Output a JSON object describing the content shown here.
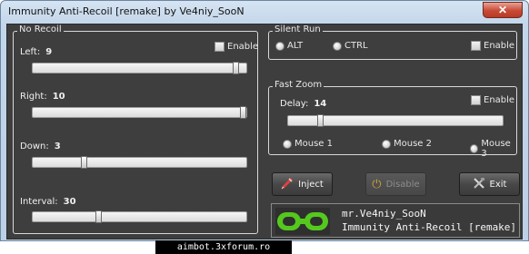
{
  "window": {
    "title": "Immunity Anti-Recoil [remake] by Ve4niy_SooN",
    "close_glyph": "✕"
  },
  "no_recoil": {
    "label": "No Recoil",
    "enable_label": "Enable",
    "sliders": [
      {
        "label": "Left:",
        "value": "9",
        "level": 0.96
      },
      {
        "label": "Right:",
        "value": "10",
        "level": 0.995
      },
      {
        "label": "Down:",
        "value": "3",
        "level": 0.23
      },
      {
        "label": "Interval:",
        "value": "30",
        "level": 0.3
      }
    ]
  },
  "silent_run": {
    "label": "Silent Run",
    "option_alt": "ALT",
    "option_ctrl": "CTRL",
    "enable_label": "Enable"
  },
  "fast_zoom": {
    "label": "Fast Zoom",
    "delay_label": "Delay:",
    "delay_value": "14",
    "delay_level": 0.14,
    "enable_label": "Enable",
    "mouse1": "Mouse 1",
    "mouse2": "Mouse 2",
    "mouse3": "Mouse 3"
  },
  "actions": {
    "inject": "Inject",
    "disable": "Disable",
    "exit": "Exit"
  },
  "logo_panel": {
    "line1": "mr.Ve4niy_SooN",
    "line2": "Immunity Anti-Recoil [remake]"
  },
  "watermark": "aimbot.3xforum.ro",
  "colors": {
    "logo_green": "#55c81e",
    "panel_bg": "#3e3e3e"
  }
}
